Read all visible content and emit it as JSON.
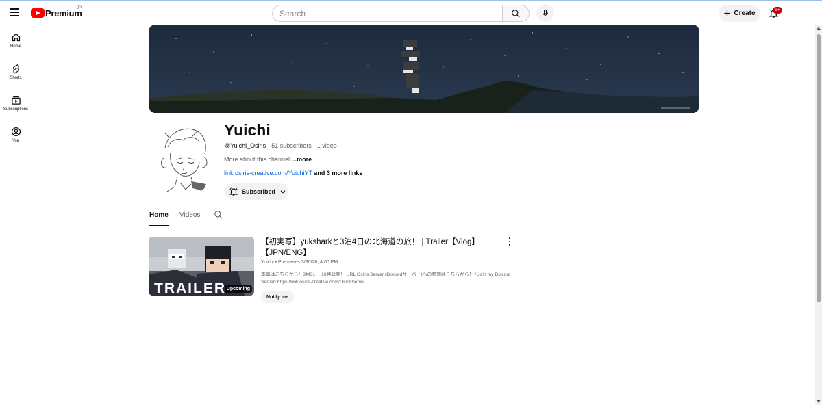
{
  "header": {
    "logo_text": "Premium",
    "logo_region": "JP",
    "search_placeholder": "Search",
    "create_label": "Create",
    "notification_count": "9+"
  },
  "guide": {
    "items": [
      {
        "label": "Home",
        "icon": "home-icon"
      },
      {
        "label": "Shorts",
        "icon": "shorts-icon"
      },
      {
        "label": "Subscriptions",
        "icon": "subscriptions-icon"
      },
      {
        "label": "You",
        "icon": "you-icon"
      }
    ]
  },
  "channel": {
    "name": "Yuichi",
    "handle": "@Yuichi_Osiris",
    "subscribers": "51 subscribers",
    "video_count": "1 video",
    "about_text": "More about this channel",
    "about_more": "...more",
    "link": "link.osiris-creative.com/YuichiYT",
    "more_links": "and 3 more links",
    "subscribe_label": "Subscribed",
    "separator": "·"
  },
  "tabs": [
    {
      "label": "Home",
      "active": true
    },
    {
      "label": "Videos",
      "active": false
    }
  ],
  "video": {
    "title": "【初実写】yuksharkと3泊4日の北海道の旅！ | Trailer【Vlog】【JPN/ENG】",
    "channel": "Yuichi",
    "premiere": "Premieres 3/30/26, 4:00 PM",
    "meta_separator": "•",
    "description": "本編はこちらから！3月31日 16時公開！ URL Osiris Server (Discordサーバー)への参加はこちらから！ / Join my Discord Server! https://link.osiris-creative.com/OsirisServe...",
    "badge": "Upcoming",
    "thumb_text": "TRAILER",
    "notify_label": "Notify me"
  },
  "colors": {
    "brand_red": "#ff0000",
    "link_blue": "#065fd4",
    "badge_red": "#cc0000",
    "banner_sky": "#1b2638"
  }
}
